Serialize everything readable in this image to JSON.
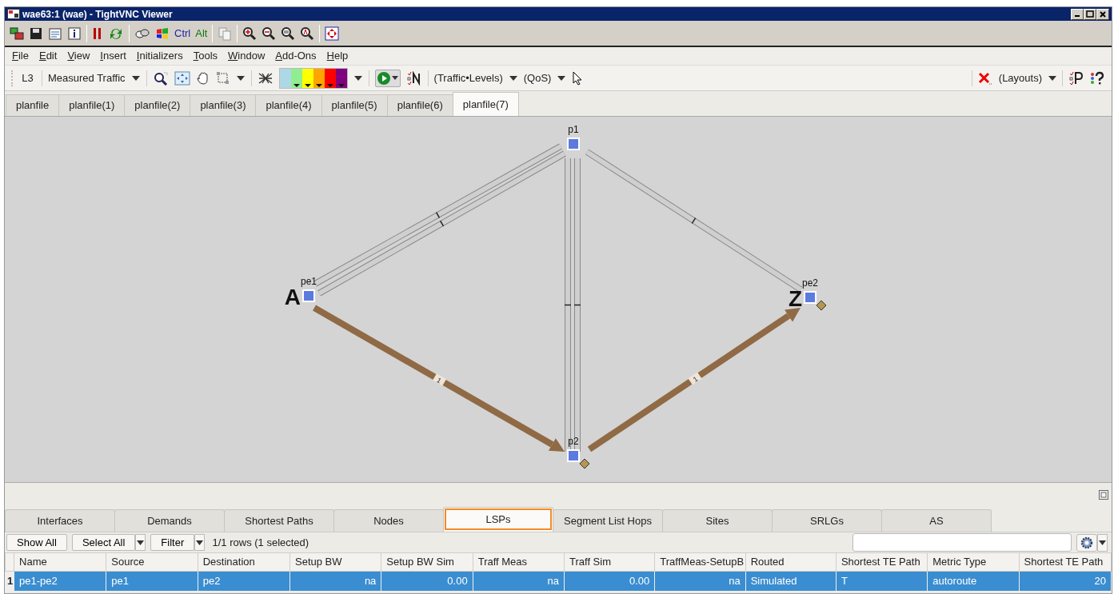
{
  "window": {
    "title": "wae63:1 (wae) - TightVNC Viewer"
  },
  "vnc_toolbar": {
    "ctrl": "Ctrl",
    "alt": "Alt"
  },
  "menu": [
    "File",
    "Edit",
    "View",
    "Insert",
    "Initializers",
    "Tools",
    "Window",
    "Add-Ons",
    "Help"
  ],
  "toolbar": {
    "layer": "L3",
    "traffic": "Measured Traffic",
    "traffic_levels": "(Traffic•Levels)",
    "qos": "(QoS)",
    "layouts": "(Layouts)",
    "palette": [
      {
        "color": "#add8e6"
      },
      {
        "color": "#90ee90"
      },
      {
        "color": "#ffff00"
      },
      {
        "color": "#ffa500"
      },
      {
        "color": "#ff0000"
      },
      {
        "color": "#800080"
      }
    ]
  },
  "plan_tabs": [
    {
      "label": "planfile",
      "selected": false
    },
    {
      "label": "planfile(1)",
      "selected": false
    },
    {
      "label": "planfile(2)",
      "selected": false
    },
    {
      "label": "planfile(3)",
      "selected": false
    },
    {
      "label": "planfile(4)",
      "selected": false
    },
    {
      "label": "planfile(5)",
      "selected": false
    },
    {
      "label": "planfile(6)",
      "selected": false
    },
    {
      "label": "planfile(7)",
      "selected": true
    }
  ],
  "network": {
    "nodes": [
      {
        "name": "p1"
      },
      {
        "name": "pe1",
        "endpoint": "A"
      },
      {
        "name": "pe2",
        "endpoint": "Z",
        "marked": true
      },
      {
        "name": "p2",
        "marked": true
      }
    ],
    "links": [
      {
        "kind": "circuit"
      },
      {
        "kind": "circuit"
      },
      {
        "kind": "circuit"
      },
      {
        "kind": "circuit"
      },
      {
        "kind": "circuit"
      },
      {
        "kind": "lsp",
        "label": "1"
      },
      {
        "kind": "lsp",
        "label": "1"
      }
    ]
  },
  "bottom_tabs": [
    {
      "label": "Interfaces",
      "selected": false
    },
    {
      "label": "Demands",
      "selected": false
    },
    {
      "label": "Shortest Paths",
      "selected": false
    },
    {
      "label": "Nodes",
      "selected": false
    },
    {
      "label": "LSPs",
      "selected": true
    },
    {
      "label": "Segment List Hops",
      "selected": false
    },
    {
      "label": "Sites",
      "selected": false
    },
    {
      "label": "SRLGs",
      "selected": false
    },
    {
      "label": "AS",
      "selected": false
    }
  ],
  "table_toolbar": {
    "show_all": "Show All",
    "select_all": "Select All",
    "filter": "Filter",
    "status": "1/1 rows (1 selected)"
  },
  "table": {
    "columns": [
      {
        "label": "Name"
      },
      {
        "label": "Source"
      },
      {
        "label": "Destination"
      },
      {
        "label": "Setup BW",
        "kind": "number"
      },
      {
        "label": "Setup BW Sim",
        "kind": "number"
      },
      {
        "label": "Traff Meas",
        "kind": "number"
      },
      {
        "label": "Traff Sim",
        "kind": "number"
      },
      {
        "label": "TraffMeas-SetupB",
        "kind": "number"
      },
      {
        "label": "Routed"
      },
      {
        "label": "Shortest TE Path"
      },
      {
        "label": "Metric Type"
      },
      {
        "label": "Shortest TE Path",
        "kind": "number"
      }
    ],
    "rows": [
      {
        "number": "1",
        "selected": true,
        "cells": [
          "pe1-pe2",
          "pe1",
          "pe2",
          "na",
          "0.00",
          "na",
          "0.00",
          "na",
          "Simulated",
          "T",
          "autoroute",
          "20"
        ]
      }
    ]
  }
}
